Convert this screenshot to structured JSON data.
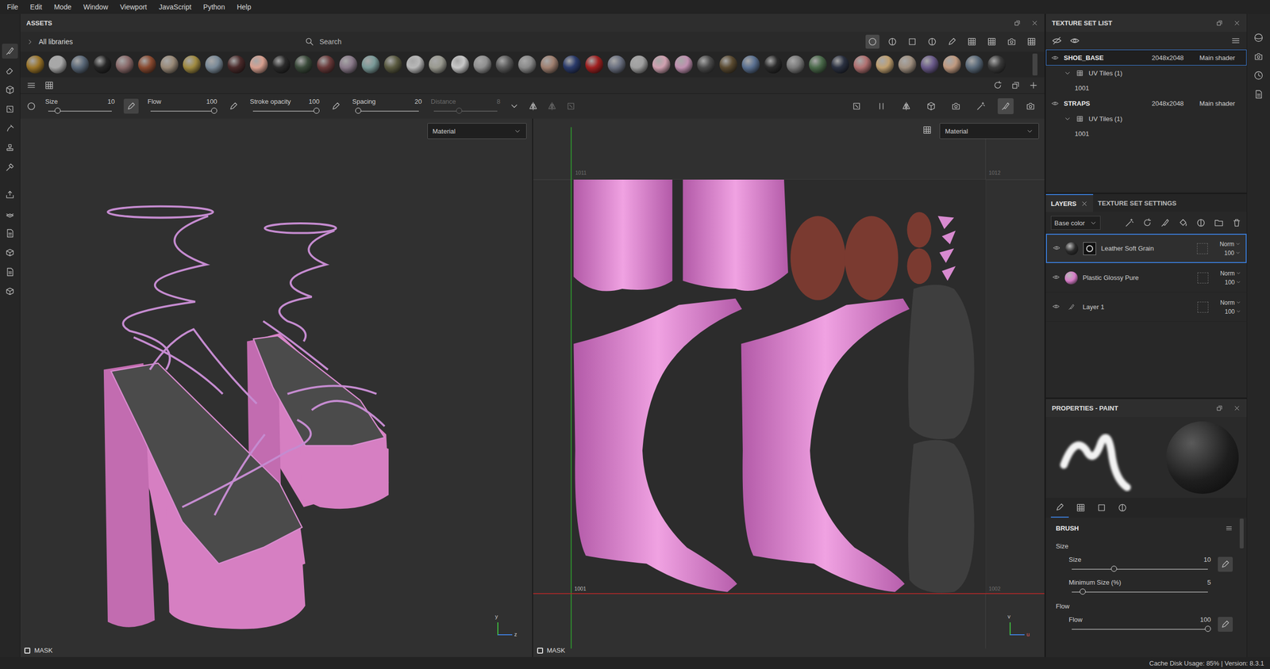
{
  "menu": [
    "File",
    "Edit",
    "Mode",
    "Window",
    "Viewport",
    "JavaScript",
    "Python",
    "Help"
  ],
  "left_tools": [
    {
      "selected": true
    },
    {
      "selected": false
    },
    {
      "selected": false
    },
    {
      "selected": false
    },
    {
      "selected": false
    },
    {
      "selected": false
    },
    {
      "selected": false
    },
    {
      "selected": false
    },
    {
      "selected": false
    },
    {
      "selected": false
    },
    {
      "selected": false
    },
    {
      "selected": false
    },
    {
      "selected": false
    }
  ],
  "assets": {
    "title": "ASSETS",
    "library": "All libraries",
    "search_placeholder": "Search",
    "materials": [
      {
        "color": "#9a7428"
      },
      {
        "color": "#a8a8a8"
      },
      {
        "color": "#5a6878"
      },
      {
        "color": "#262626"
      },
      {
        "color": "#8a6a6a"
      },
      {
        "color": "#8a4a30"
      },
      {
        "color": "#9a8a78"
      },
      {
        "color": "#a08a40"
      },
      {
        "color": "#7a8a98"
      },
      {
        "color": "#4a2a2a"
      },
      {
        "color": "#d8a090"
      },
      {
        "color": "#2a2a2a"
      },
      {
        "color": "#3a4a3a"
      },
      {
        "color": "#6a3a3a"
      },
      {
        "color": "#8a7a8a"
      },
      {
        "color": "#7a9a98"
      },
      {
        "color": "#5a5a40"
      },
      {
        "color": "#b8b8b8"
      },
      {
        "color": "#9a9a90"
      },
      {
        "color": "#c8c8c8"
      },
      {
        "color": "#909090"
      },
      {
        "color": "#5a5a5a"
      },
      {
        "color": "#8a8a8a"
      },
      {
        "color": "#a08070"
      },
      {
        "color": "#2a3a6a"
      },
      {
        "color": "#a02020"
      },
      {
        "color": "#6a7080"
      },
      {
        "color": "#a0a0a0"
      },
      {
        "color": "#d0a0b0"
      },
      {
        "color": "#c090b0"
      },
      {
        "color": "#4a4a4a"
      },
      {
        "color": "#5a4a30"
      },
      {
        "color": "#5a7090"
      },
      {
        "color": "#2a2a2a"
      },
      {
        "color": "#7a7a7a"
      },
      {
        "color": "#4a6a4a"
      },
      {
        "color": "#2a3040"
      },
      {
        "color": "#b07070"
      },
      {
        "color": "#c0a070"
      },
      {
        "color": "#a09080"
      },
      {
        "color": "#6a5a8a"
      },
      {
        "color": "#c09a80"
      },
      {
        "color": "#5a6a7a"
      },
      {
        "color": "#3a3a3a"
      }
    ]
  },
  "tool_options": {
    "sliders": [
      {
        "label": "Size",
        "value": "10",
        "level": 0.15,
        "disabled": false
      },
      {
        "label": "Flow",
        "value": "100",
        "level": 1,
        "disabled": false
      },
      {
        "label": "Stroke opacity",
        "value": "100",
        "level": 1,
        "disabled": false
      },
      {
        "label": "Spacing",
        "value": "20",
        "level": 0.05,
        "disabled": false
      },
      {
        "label": "Distance",
        "value": "8",
        "level": 0.4,
        "disabled": true
      }
    ],
    "viewport_tools": [
      {
        "selected": false
      },
      {
        "selected": false
      },
      {
        "selected": false
      },
      {
        "selected": false
      },
      {
        "selected": false
      },
      {
        "selected": false
      },
      {
        "selected": true
      },
      {
        "selected": false
      }
    ]
  },
  "viewport_3d": {
    "mode": "Material",
    "mask_label": "MASK",
    "mask_checked": false,
    "axes": [
      "y",
      "z"
    ]
  },
  "viewport_2d": {
    "mode": "Material",
    "mask_label": "MASK",
    "mask_checked": false,
    "axes": [
      "v",
      "u"
    ],
    "tiles": [
      "1011",
      "1012",
      "1001",
      "1002"
    ]
  },
  "texture_set_list": {
    "title": "TEXTURE SET LIST",
    "sets": [
      {
        "name": "SHOE_BASE",
        "resolution": "2048x2048",
        "shader": "Main shader",
        "selected": true,
        "expanded": true,
        "uv": "UV Tiles (1)",
        "tile": "1001"
      },
      {
        "name": "STRAPS",
        "resolution": "2048x2048",
        "shader": "Main shader",
        "selected": false,
        "expanded": true,
        "uv": "UV Tiles (1)",
        "tile": "1001"
      }
    ]
  },
  "layers": {
    "tabs": [
      {
        "label": "LAYERS",
        "selected": true
      },
      {
        "label": "TEXTURE SET SETTINGS",
        "selected": false
      }
    ],
    "channel": "Base color",
    "items": [
      {
        "name": "Leather Soft Grain",
        "kind": "fill",
        "color": "#2a2a2a",
        "has_mask": true,
        "blend": "Norm",
        "opacity": "100",
        "selected": true,
        "visible": true
      },
      {
        "name": "Plastic Glossy Pure",
        "kind": "fill",
        "color": "#d77cc8",
        "has_mask": false,
        "blend": "Norm",
        "opacity": "100",
        "selected": false,
        "visible": true
      },
      {
        "name": "Layer 1",
        "kind": "paint",
        "color": "#bbbbbb",
        "has_mask": false,
        "blend": "Norm",
        "opacity": "100",
        "selected": false,
        "visible": true
      }
    ]
  },
  "properties": {
    "title": "PROPERTIES - PAINT",
    "tabs": [
      {
        "selected": true
      },
      {
        "selected": false
      },
      {
        "selected": false
      },
      {
        "selected": false
      }
    ],
    "section": "BRUSH",
    "groups": [
      {
        "label": "Size",
        "sliders": [
          {
            "label": "Size",
            "value": "10",
            "level": 0.31,
            "pressure": true
          },
          {
            "label": "Minimum Size (%)",
            "value": "5",
            "level": 0.08,
            "pressure": false
          }
        ]
      },
      {
        "label": "Flow",
        "sliders": [
          {
            "label": "Flow",
            "value": "100",
            "level": 1,
            "pressure": true
          }
        ]
      }
    ]
  },
  "status_bar": {
    "text": "Cache Disk Usage: 85% | Version: 8.3.1"
  }
}
